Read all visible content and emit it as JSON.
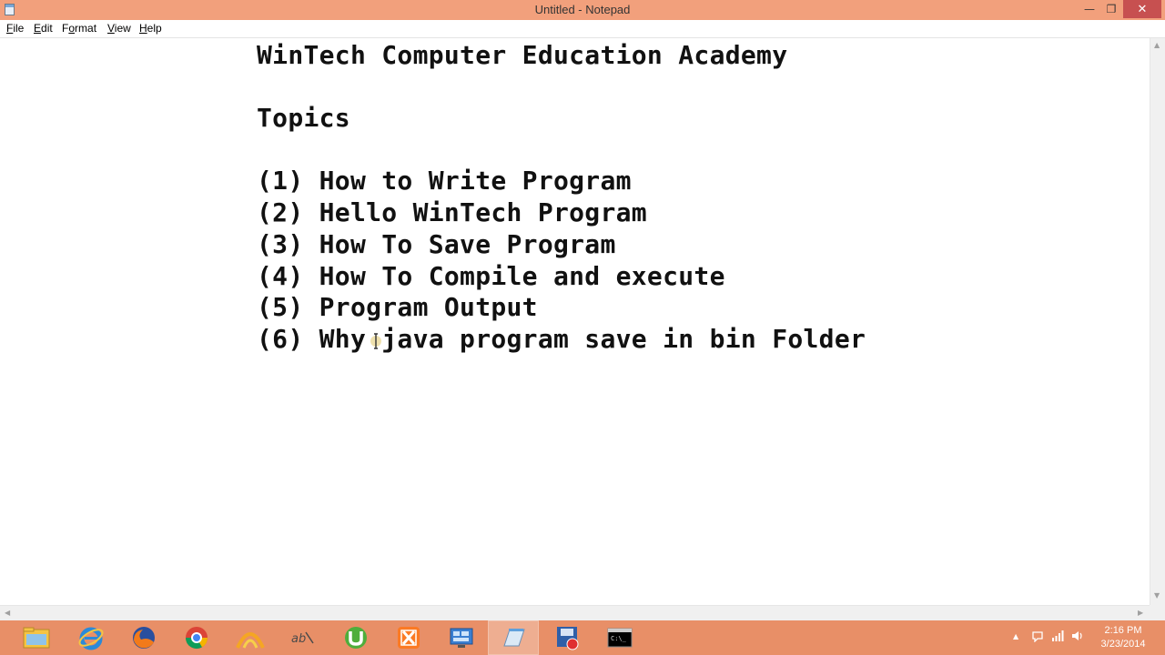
{
  "window": {
    "title": "Untitled - Notepad",
    "minimize_glyph": "—",
    "restore_glyph": "❐",
    "close_glyph": "✕"
  },
  "menu": {
    "items": [
      {
        "underline": "F",
        "rest": "ile"
      },
      {
        "underline": "E",
        "rest": "dit"
      },
      {
        "underline": "",
        "first": "F",
        "underline_mid": "o",
        "rest": "rmat"
      },
      {
        "underline": "V",
        "rest": "iew"
      },
      {
        "underline": "H",
        "rest": "elp"
      }
    ]
  },
  "document": {
    "lines": [
      "WinTech Computer Education Academy",
      "Topics",
      "(1) How to Write Program",
      "(2) Hello WinTech Program",
      "(3) How To Save Program",
      "(4) How To Compile and execute",
      "(5) Program Output",
      "(6) Why java program save in bin Folder"
    ]
  },
  "taskbar": {
    "apps": [
      {
        "name": "file-explorer-icon"
      },
      {
        "name": "internet-explorer-icon"
      },
      {
        "name": "firefox-icon"
      },
      {
        "name": "chrome-icon"
      },
      {
        "name": "app-arch-icon"
      },
      {
        "name": "app-script-icon"
      },
      {
        "name": "utorrent-icon"
      },
      {
        "name": "xampp-icon"
      },
      {
        "name": "remote-desktop-icon"
      },
      {
        "name": "notepad-icon"
      },
      {
        "name": "recorder-icon"
      },
      {
        "name": "command-prompt-icon"
      }
    ],
    "clock": {
      "time": "2:16 PM",
      "date": "3/23/2014"
    }
  },
  "colors": {
    "titlebar": "#f2a07c",
    "taskbar": "#e88f67",
    "close": "#c75050"
  }
}
